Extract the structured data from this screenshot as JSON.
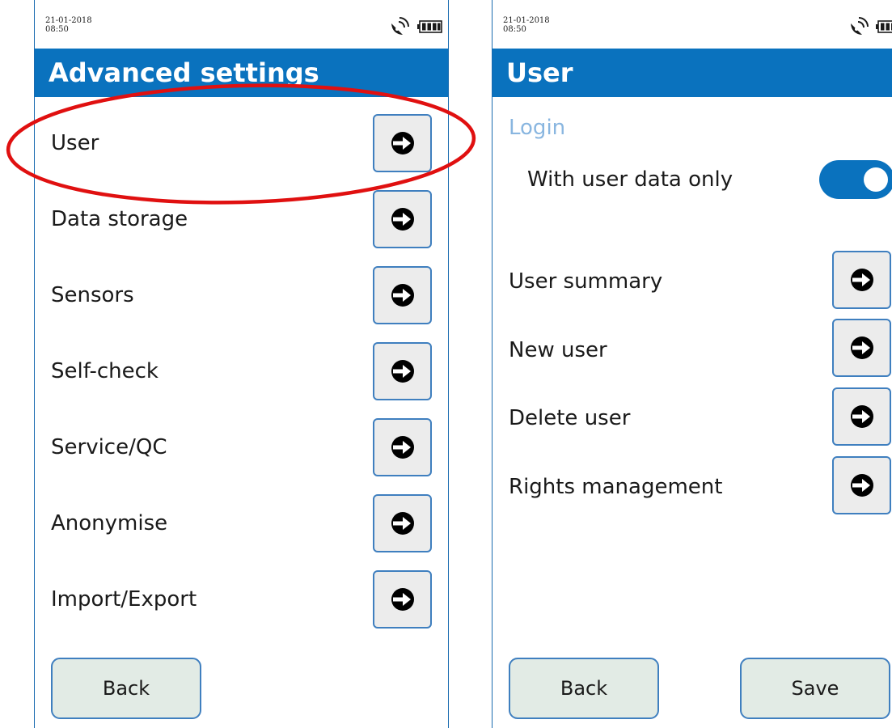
{
  "left_screen": {
    "status": {
      "date": "21-01-2018",
      "time": "08:50"
    },
    "title": "Advanced settings",
    "menu_items": [
      {
        "label": "User"
      },
      {
        "label": "Data storage"
      },
      {
        "label": "Sensors"
      },
      {
        "label": "Self-check"
      },
      {
        "label": "Service/QC"
      },
      {
        "label": "Anonymise"
      },
      {
        "label": "Import/Export"
      }
    ],
    "back_label": "Back"
  },
  "right_screen": {
    "status": {
      "date": "21-01-2018",
      "time": "08:50"
    },
    "title": "User",
    "section_login": "Login",
    "toggle": {
      "label": "With user data only",
      "state": "on"
    },
    "menu_items": [
      {
        "label": "User summary"
      },
      {
        "label": "New user"
      },
      {
        "label": "Delete user"
      },
      {
        "label": "Rights management"
      }
    ],
    "back_label": "Back",
    "save_label": "Save"
  },
  "annotation": {
    "highlighted_item": "User",
    "color": "#e01010"
  },
  "colors": {
    "header": "#0a72be",
    "button_border": "#3f7fbf",
    "section": "#89b6e0",
    "bottom_button_bg": "#e2ebe5"
  },
  "icons": [
    "satellite-icon",
    "battery-icon",
    "arrow-right-icon"
  ]
}
